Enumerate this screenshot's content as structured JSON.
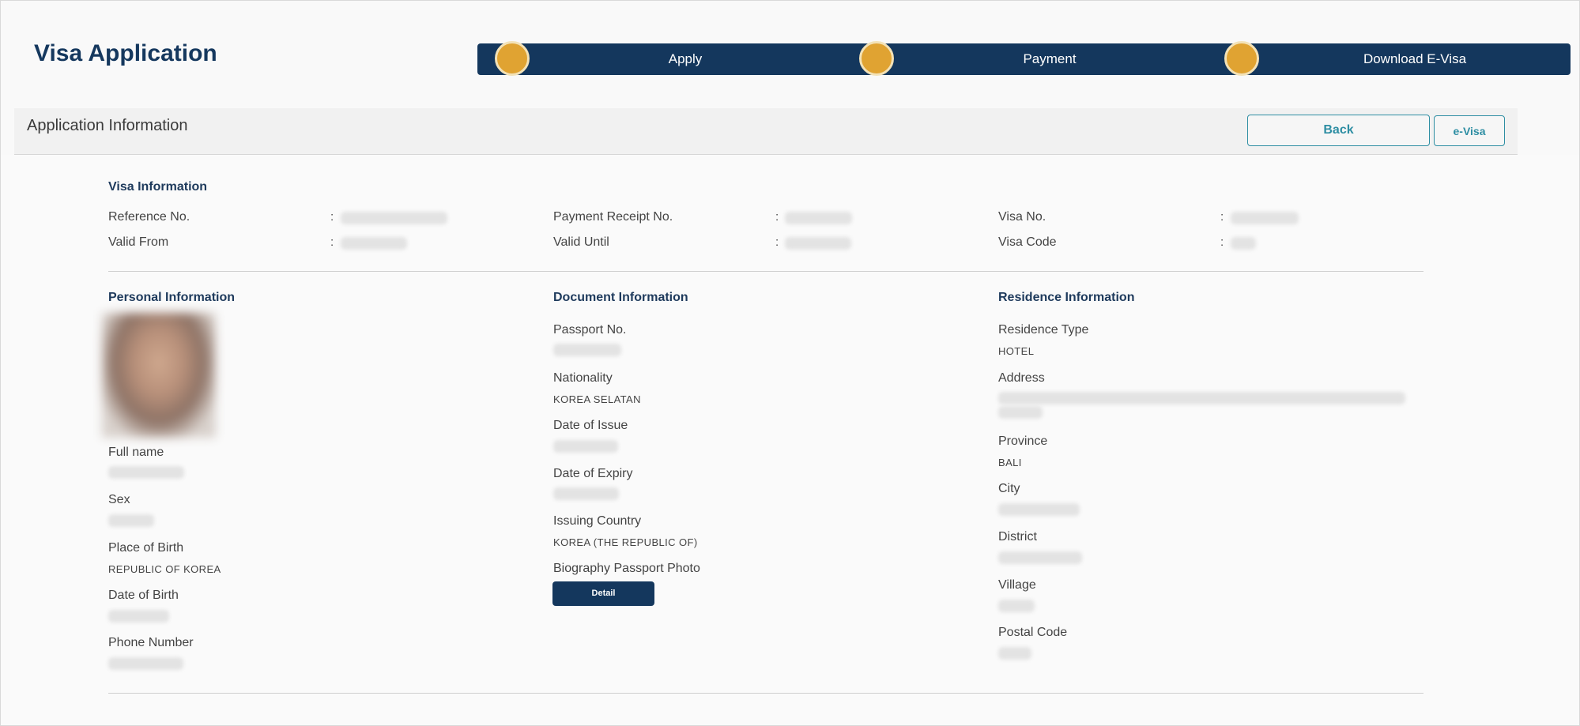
{
  "header": {
    "title": "Visa Application",
    "steps": [
      {
        "label": "Apply"
      },
      {
        "label": "Payment"
      },
      {
        "label": "Download E-Visa"
      }
    ],
    "step_color": "#e0a332",
    "bar_color": "#14375d"
  },
  "panel": {
    "title": "Application Information",
    "back_label": "Back",
    "evisa_label": "e-Visa"
  },
  "visa_info": {
    "heading": "Visa Information",
    "colon": ":",
    "fields": {
      "reference_no": "Reference No.",
      "payment_receipt_no": "Payment Receipt No.",
      "visa_no": "Visa No.",
      "valid_from": "Valid From",
      "valid_until": "Valid Until",
      "visa_code": "Visa Code"
    }
  },
  "personal": {
    "heading": "Personal Information",
    "photo_icon": "profile-photo",
    "full_name_label": "Full name",
    "sex_label": "Sex",
    "place_of_birth_label": "Place of Birth",
    "place_of_birth_value": "REPUBLIC OF KOREA",
    "date_of_birth_label": "Date of Birth",
    "phone_label": "Phone Number"
  },
  "document": {
    "heading": "Document Information",
    "passport_label": "Passport No.",
    "nationality_label": "Nationality",
    "nationality_value": "KOREA SELATAN",
    "date_issue_label": "Date of Issue",
    "date_expiry_label": "Date of Expiry",
    "issuing_country_label": "Issuing Country",
    "issuing_country_value": "KOREA (THE REPUBLIC OF)",
    "bio_photo_label": "Biography Passport Photo",
    "detail_label": "Detail"
  },
  "residence": {
    "heading": "Residence Information",
    "type_label": "Residence Type",
    "type_value": "HOTEL",
    "address_label": "Address",
    "province_label": "Province",
    "province_value": "BALI",
    "city_label": "City",
    "district_label": "District",
    "village_label": "Village",
    "postal_label": "Postal Code"
  }
}
